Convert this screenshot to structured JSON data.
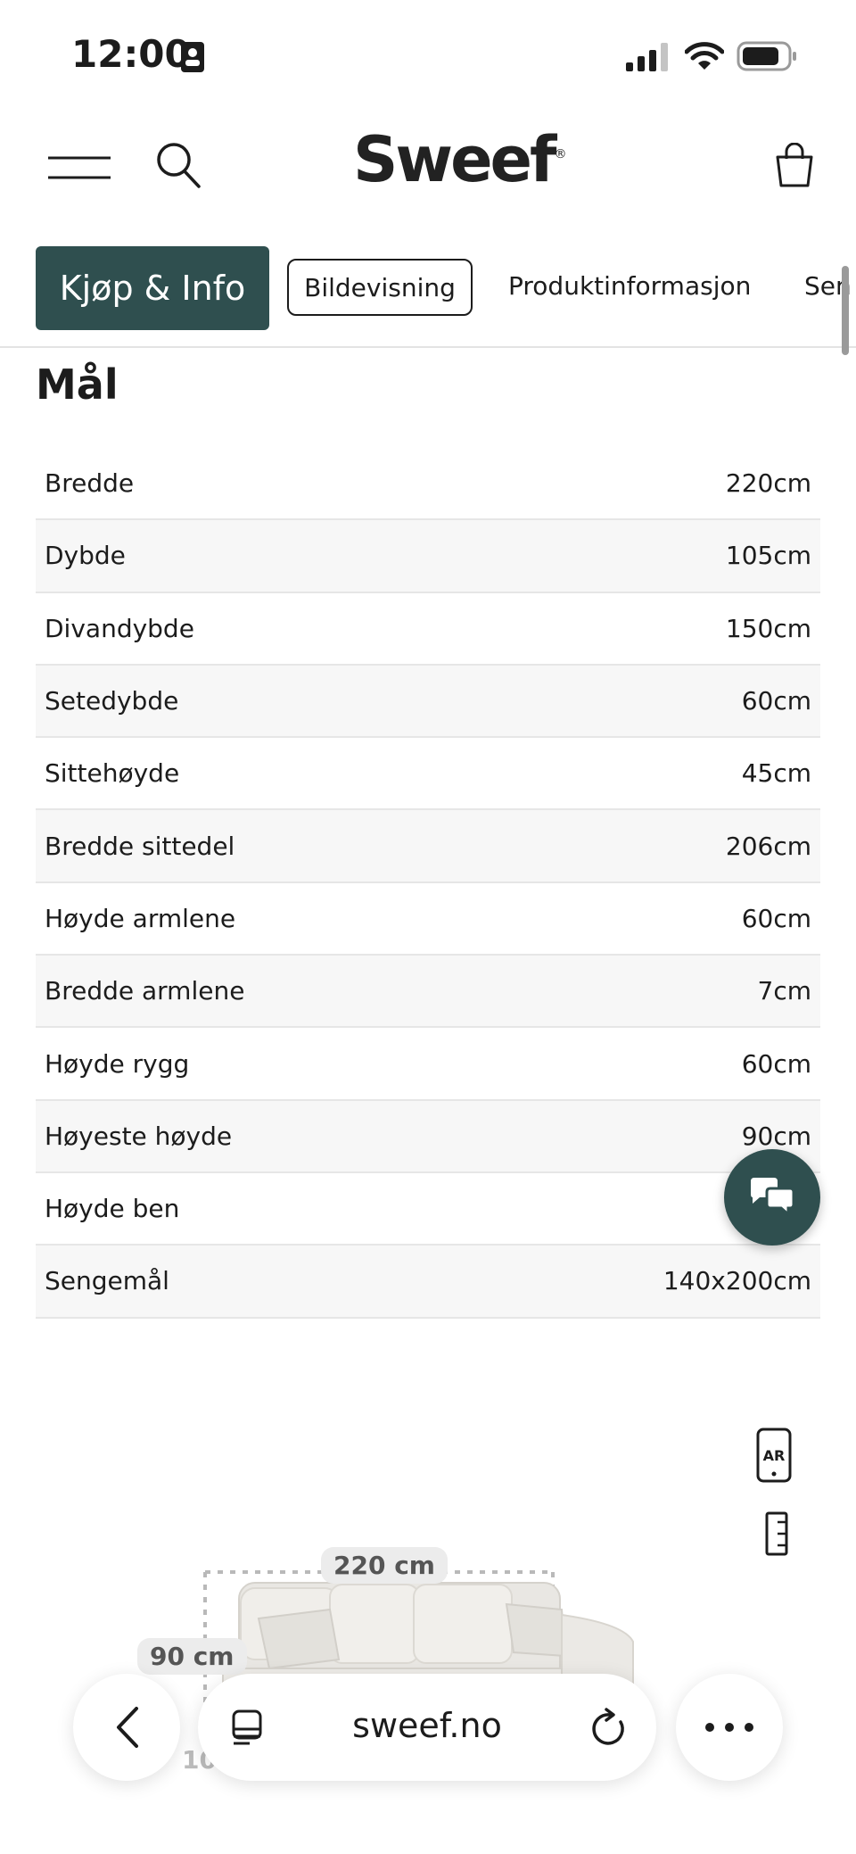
{
  "status_bar": {
    "time": "12:00"
  },
  "header": {
    "logo": "Sweef",
    "logo_mark": "®"
  },
  "tabs": [
    {
      "label": "Kjøp & Info"
    },
    {
      "label": "Bildevisning"
    },
    {
      "label": "Produktinformasjon"
    },
    {
      "label": "Sen"
    }
  ],
  "section": {
    "title": "Mål"
  },
  "specs": [
    {
      "label": "Bredde",
      "value": "220cm"
    },
    {
      "label": "Dybde",
      "value": "105cm"
    },
    {
      "label": "Divandybde",
      "value": "150cm"
    },
    {
      "label": "Setedybde",
      "value": "60cm"
    },
    {
      "label": "Sittehøyde",
      "value": "45cm"
    },
    {
      "label": "Bredde sittedel",
      "value": "206cm"
    },
    {
      "label": "Høyde armlene",
      "value": "60cm"
    },
    {
      "label": "Bredde armlene",
      "value": "7cm"
    },
    {
      "label": "Høyde rygg",
      "value": "60cm"
    },
    {
      "label": "Høyeste høyde",
      "value": "90cm"
    },
    {
      "label": "Høyde ben",
      "value": ""
    },
    {
      "label": "Sengemål",
      "value": "140x200cm"
    }
  ],
  "product_view": {
    "ar_label": "AR",
    "dim_width": "220 cm",
    "dim_height": "90 cm",
    "dim_depth": "105"
  },
  "browser": {
    "url": "sweef.no"
  },
  "colors": {
    "accent": "#2f4f4f"
  }
}
